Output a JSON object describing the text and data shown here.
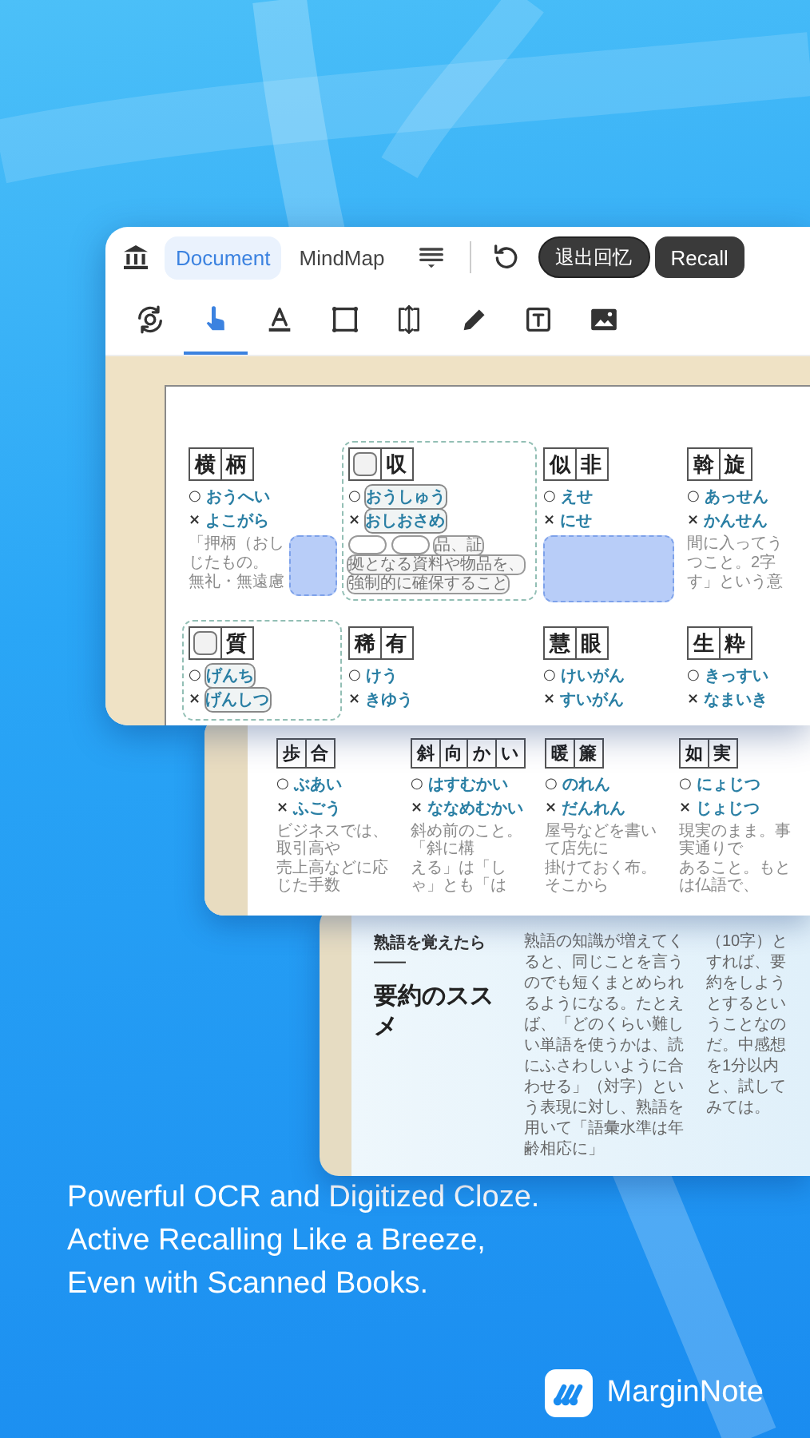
{
  "toolbar": {
    "tabs": [
      {
        "label": "Document",
        "selected": true
      },
      {
        "label": "MindMap",
        "selected": false
      }
    ],
    "buttons": [
      {
        "kind": "exit",
        "label": "退出回忆"
      },
      {
        "kind": "recall",
        "label": "Recall"
      }
    ]
  },
  "tools": [
    {
      "kind": "rotate",
      "selected": false
    },
    {
      "kind": "hand",
      "selected": true
    },
    {
      "kind": "underline",
      "selected": false
    },
    {
      "kind": "rect",
      "selected": false
    },
    {
      "kind": "resize",
      "selected": false
    },
    {
      "kind": "pencil",
      "selected": false
    },
    {
      "kind": "textbox",
      "selected": false
    },
    {
      "kind": "image",
      "selected": false
    }
  ],
  "page": {
    "cards": [
      {
        "recall_group": false,
        "chars": [
          {
            "kind": "char",
            "text": "横"
          },
          {
            "kind": "char",
            "text": "柄"
          }
        ],
        "readings": [
          {
            "mark": "○",
            "text": "おうへい",
            "cloze": false
          },
          {
            "mark": "×",
            "text": "よこがら",
            "cloze": false
          }
        ],
        "body": [
          [
            {
              "kind": "text",
              "text": "「押柄（おし",
              "cloze": false
            }
          ],
          [
            {
              "kind": "text",
              "text": "じたもの。",
              "cloze": false
            }
          ],
          [
            {
              "kind": "text",
              "text": "無礼・無遠慮",
              "cloze": false
            }
          ]
        ],
        "covered": true
      },
      {
        "recall_group": true,
        "chars": [
          {
            "kind": "blank"
          },
          {
            "kind": "char",
            "text": "収"
          }
        ],
        "readings": [
          {
            "mark": "○",
            "text": "おうしゅう",
            "cloze": true
          },
          {
            "mark": "×",
            "text": "おしおさめ",
            "cloze": true
          }
        ],
        "body": [
          [
            {
              "kind": "blank"
            },
            {
              "kind": "blank"
            },
            {
              "kind": "text",
              "text": "品、証",
              "cloze": true
            }
          ],
          [
            {
              "kind": "text",
              "text": "拠となる資料や物品を、",
              "cloze": true
            }
          ],
          [
            {
              "kind": "text",
              "text": "強制的に確保すること",
              "cloze": true
            }
          ]
        ],
        "covered": false
      },
      {
        "recall_group": false,
        "chars": [
          {
            "kind": "char",
            "text": "似"
          },
          {
            "kind": "char",
            "text": "非"
          }
        ],
        "readings": [
          {
            "mark": "○",
            "text": "えせ",
            "cloze": false
          },
          {
            "mark": "×",
            "text": "にせ",
            "cloze": false
          }
        ],
        "covered": true
      },
      {
        "recall_group": false,
        "chars": [
          {
            "kind": "char",
            "text": "斡"
          },
          {
            "kind": "char",
            "text": "旋"
          }
        ],
        "readings": [
          {
            "mark": "○",
            "text": "あっせん",
            "cloze": false
          },
          {
            "mark": "×",
            "text": "かんせん",
            "cloze": false
          }
        ],
        "body": [
          [
            {
              "kind": "text",
              "text": "間に入ってう",
              "cloze": false
            }
          ],
          [
            {
              "kind": "text",
              "text": "つこと。2字",
              "cloze": false
            }
          ],
          [
            {
              "kind": "text",
              "text": "す」という意",
              "cloze": false
            }
          ]
        ],
        "covered": false
      },
      {
        "recall_group": true,
        "chars": [
          {
            "kind": "blank"
          },
          {
            "kind": "char",
            "text": "質"
          }
        ],
        "readings": [
          {
            "mark": "○",
            "text": "げんち",
            "cloze": true
          },
          {
            "mark": "×",
            "text": "げんしつ",
            "cloze": true
          }
        ],
        "covered": false
      },
      {
        "recall_group": false,
        "chars": [
          {
            "kind": "char",
            "text": "稀"
          },
          {
            "kind": "char",
            "text": "有"
          }
        ],
        "readings": [
          {
            "mark": "○",
            "text": "けう",
            "cloze": false
          },
          {
            "mark": "×",
            "text": "きゆう",
            "cloze": false
          }
        ],
        "covered": false
      },
      {
        "recall_group": false,
        "chars": [
          {
            "kind": "char",
            "text": "慧"
          },
          {
            "kind": "char",
            "text": "眼"
          }
        ],
        "readings": [
          {
            "mark": "○",
            "text": "けいがん",
            "cloze": false
          },
          {
            "mark": "×",
            "text": "すいがん",
            "cloze": false
          }
        ],
        "covered": false
      },
      {
        "recall_group": false,
        "chars": [
          {
            "kind": "char",
            "text": "生"
          },
          {
            "kind": "char",
            "text": "粋"
          }
        ],
        "readings": [
          {
            "mark": "○",
            "text": "きっすい",
            "cloze": false
          },
          {
            "mark": "×",
            "text": "なまいき",
            "cloze": false
          }
        ],
        "covered": false
      }
    ]
  },
  "strip_page": {
    "cards": [
      {
        "recall_group": false,
        "chars": [
          {
            "kind": "char",
            "text": "歩"
          },
          {
            "kind": "char",
            "text": "合"
          }
        ],
        "readings": [
          {
            "mark": "○",
            "text": "ぶあい",
            "cloze": false
          },
          {
            "mark": "×",
            "text": "ふごう",
            "cloze": false
          }
        ],
        "body": [
          [
            {
              "kind": "text",
              "text": "ビジネスでは、取引高や",
              "cloze": false
            }
          ],
          [
            {
              "kind": "text",
              "text": "売上高などに応じた手数",
              "cloze": false
            }
          ]
        ],
        "covered": false
      },
      {
        "recall_group": false,
        "chars": [
          {
            "kind": "char",
            "text": "斜"
          },
          {
            "kind": "char",
            "text": "向"
          },
          {
            "kind": "char",
            "text": "か"
          },
          {
            "kind": "char",
            "text": "い"
          }
        ],
        "readings": [
          {
            "mark": "○",
            "text": "はすむかい",
            "cloze": false
          },
          {
            "mark": "×",
            "text": "ななめむかい",
            "cloze": false
          }
        ],
        "body": [
          [
            {
              "kind": "text",
              "text": "斜め前のこと。「斜に構",
              "cloze": false
            }
          ],
          [
            {
              "kind": "text",
              "text": "える」は「しゃ」とも「は",
              "cloze": false
            }
          ]
        ],
        "covered": false
      },
      {
        "recall_group": false,
        "chars": [
          {
            "kind": "char",
            "text": "暖"
          },
          {
            "kind": "char",
            "text": "簾"
          }
        ],
        "readings": [
          {
            "mark": "○",
            "text": "のれん",
            "cloze": false
          },
          {
            "mark": "×",
            "text": "だんれん",
            "cloze": false
          }
        ],
        "body": [
          [
            {
              "kind": "text",
              "text": "屋号などを書いて店先に",
              "cloze": false
            }
          ],
          [
            {
              "kind": "text",
              "text": "掛けておく布。そこから",
              "cloze": false
            }
          ]
        ],
        "covered": false
      },
      {
        "recall_group": false,
        "chars": [
          {
            "kind": "char",
            "text": "如"
          },
          {
            "kind": "char",
            "text": "実"
          }
        ],
        "readings": [
          {
            "mark": "○",
            "text": "にょじつ",
            "cloze": false
          },
          {
            "mark": "×",
            "text": "じょじつ",
            "cloze": false
          }
        ],
        "body": [
          [
            {
              "kind": "text",
              "text": "現実のまま。事実通りで",
              "cloze": false
            }
          ],
          [
            {
              "kind": "text",
              "text": "あること。もとは仏語で、",
              "cloze": false
            }
          ]
        ],
        "covered": false
      }
    ]
  },
  "summary_page": {
    "kicker": "熟語を覚えたら——",
    "title": "要約のススメ",
    "columns": [
      "熟語の知識が増えてくると、同じことを言うのでも短くまとめられるようになる。たとえば、「どのくらい難しい単語を使うかは、読にふさわしいように合わせる」（対字）という表現に対し、熟語を用いて「語彙水準は年齢相応に」",
      "（10字）とすれば、要約をしようとするということなのだ。中感想を1分以内と、試してみては。"
    ]
  },
  "tagline": [
    "Powerful OCR and Digitized Cloze.",
    "Active Recalling Like a Breeze,",
    "Even with Scanned Books."
  ],
  "brand": {
    "name": "MarginNote"
  }
}
